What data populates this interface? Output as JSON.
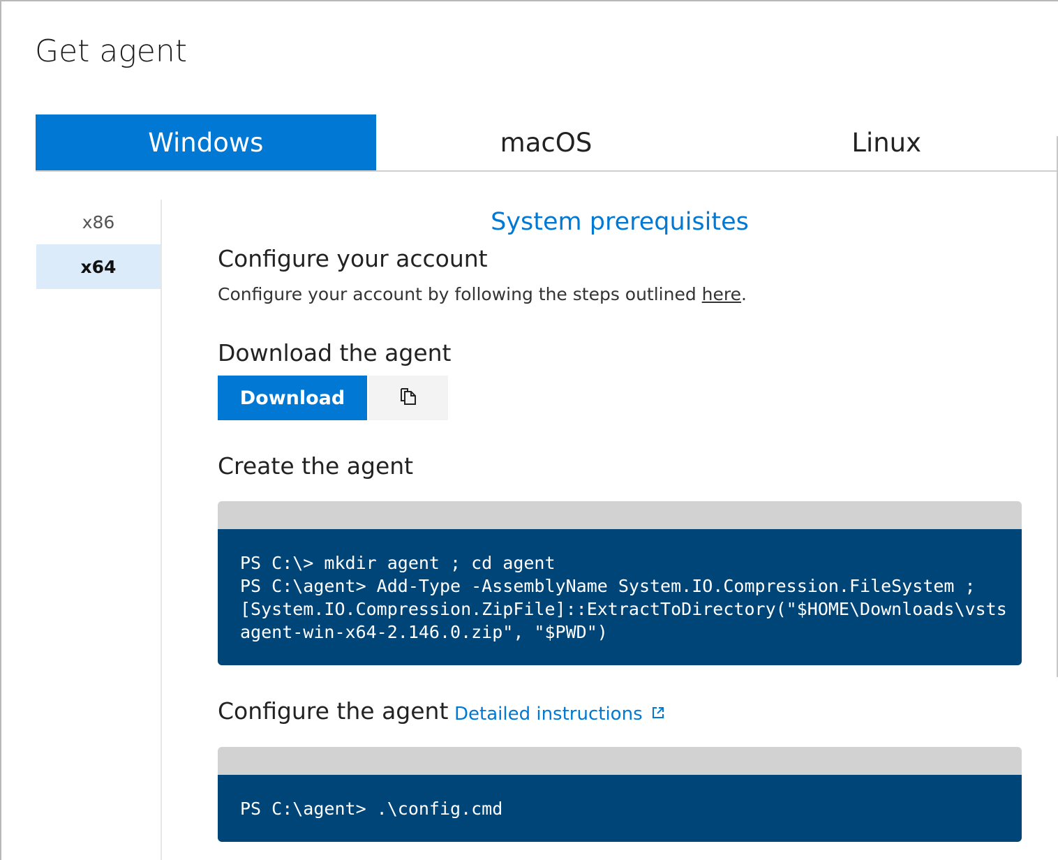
{
  "page": {
    "title": "Get agent"
  },
  "os_tabs": [
    {
      "label": "Windows",
      "active": true
    },
    {
      "label": "macOS",
      "active": false
    },
    {
      "label": "Linux",
      "active": false
    }
  ],
  "arch": [
    {
      "label": "x86",
      "active": false
    },
    {
      "label": "x64",
      "active": true
    }
  ],
  "prereq_link": "System prerequisites",
  "configure_account": {
    "heading": "Configure your account",
    "text_before": "Configure your account by following the steps outlined ",
    "link": "here",
    "text_after": "."
  },
  "download": {
    "heading": "Download the agent",
    "button_label": "Download",
    "copy_icon": "copy-icon"
  },
  "create": {
    "heading": "Create the agent",
    "code": [
      "PS C:\\> mkdir agent ; cd agent",
      "PS C:\\agent> Add-Type -AssemblyName System.IO.Compression.FileSystem ;",
      "[System.IO.Compression.ZipFile]::ExtractToDirectory(\"$HOME\\Downloads\\vsts",
      "agent-win-x64-2.146.0.zip\", \"$PWD\")"
    ]
  },
  "configure_agent": {
    "heading": "Configure the agent",
    "link": "Detailed instructions",
    "link_icon": "external-link-icon",
    "code": [
      "PS C:\\agent> .\\config.cmd"
    ]
  },
  "colors": {
    "accent": "#0078d4",
    "code_bg": "#004578",
    "code_header": "#d2d2d2",
    "selected_arch_bg": "#dcebf9"
  }
}
